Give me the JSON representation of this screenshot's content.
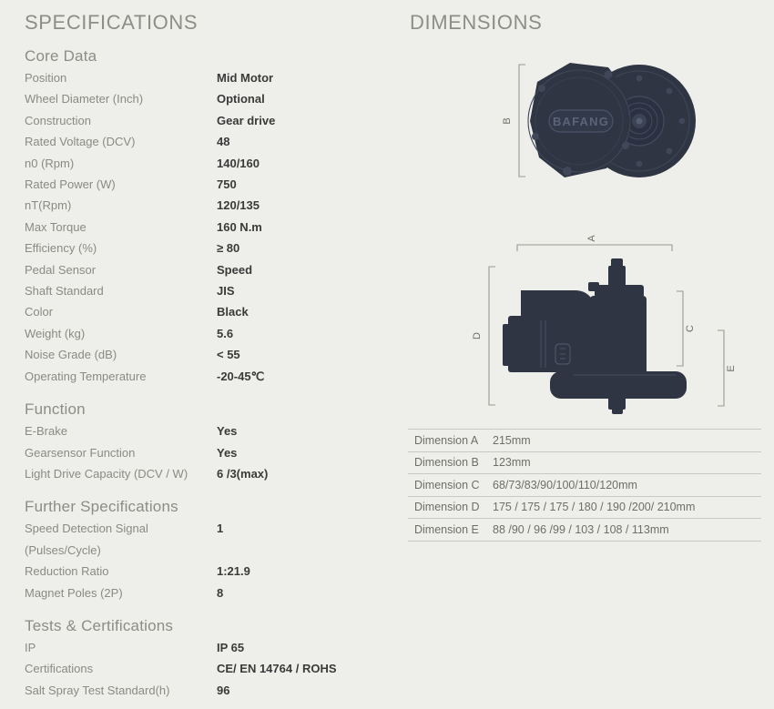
{
  "headers": {
    "specifications": "SPECIFICATIONS",
    "dimensions": "DIMENSIONS"
  },
  "specifications": {
    "groups": [
      {
        "title": "Core Data",
        "rows": [
          {
            "label": "Position",
            "value": "Mid Motor"
          },
          {
            "label": "Wheel Diameter (Inch)",
            "value": "Optional"
          },
          {
            "label": "Construction",
            "value": "Gear drive"
          },
          {
            "label": "Rated Voltage (DCV)",
            "value": "48"
          },
          {
            "label": "n0 (Rpm)",
            "value": "140/160"
          },
          {
            "label": "Rated Power (W)",
            "value": "750"
          },
          {
            "label": "nT(Rpm)",
            "value": "120/135"
          },
          {
            "label": "Max Torque",
            "value": "160 N.m"
          },
          {
            "label": "Efficiency (%)",
            "value": "≥ 80"
          },
          {
            "label": "Pedal Sensor",
            "value": "Speed"
          },
          {
            "label": "Shaft Standard",
            "value": "JIS"
          },
          {
            "label": "Color",
            "value": "Black"
          },
          {
            "label": "Weight (kg)",
            "value": "5.6"
          },
          {
            "label": "Noise Grade (dB)",
            "value": "< 55"
          },
          {
            "label": "Operating Temperature",
            "value": "-20-45℃"
          }
        ]
      },
      {
        "title": "Function",
        "rows": [
          {
            "label": "E-Brake",
            "value": "Yes"
          },
          {
            "label": "Gearsensor Function",
            "value": "Yes"
          },
          {
            "label": "Light Drive Capacity (DCV / W)",
            "value": "6 /3(max)"
          }
        ]
      },
      {
        "title": "Further Specifications",
        "rows": [
          {
            "label": "Speed Detection Signal (Pulses/Cycle)",
            "value": "1"
          },
          {
            "label": "Reduction Ratio",
            "value": "1:21.9"
          },
          {
            "label": "Magnet Poles (2P)",
            "value": "8"
          }
        ]
      },
      {
        "title": "Tests & Certifications",
        "rows": [
          {
            "label": "IP",
            "value": "IP 65"
          },
          {
            "label": "Certifications",
            "value": "CE/ EN 14764 / ROHS"
          },
          {
            "label": "Salt Spray Test Standard(h)",
            "value": "96"
          }
        ]
      }
    ]
  },
  "dimensions": {
    "figure_top": {
      "caption_label": "B",
      "brand_text": "BAFANG"
    },
    "figure_bottom": {
      "caption_labels": [
        "A",
        "C",
        "D",
        "E"
      ]
    },
    "table": [
      {
        "key": "Dimension A",
        "value": "215mm"
      },
      {
        "key": "Dimension B",
        "value": "123mm"
      },
      {
        "key": "Dimension C",
        "value": "68/73/83/90/100/110/120mm"
      },
      {
        "key": "Dimension D",
        "value": "175 / 175 / 175 / 180 / 190 /200/ 210mm"
      },
      {
        "key": "Dimension E",
        "value": "88 /90 / 96 /99 / 103 / 108 / 113mm"
      }
    ]
  },
  "colors": {
    "background": "#eeeeea",
    "motor_dark": "#2f3542",
    "motor_outline": "#3d4557",
    "label_gray": "#8b8b85",
    "value_dark": "#3a3a3a",
    "rule_gray": "#c9c9c3"
  }
}
